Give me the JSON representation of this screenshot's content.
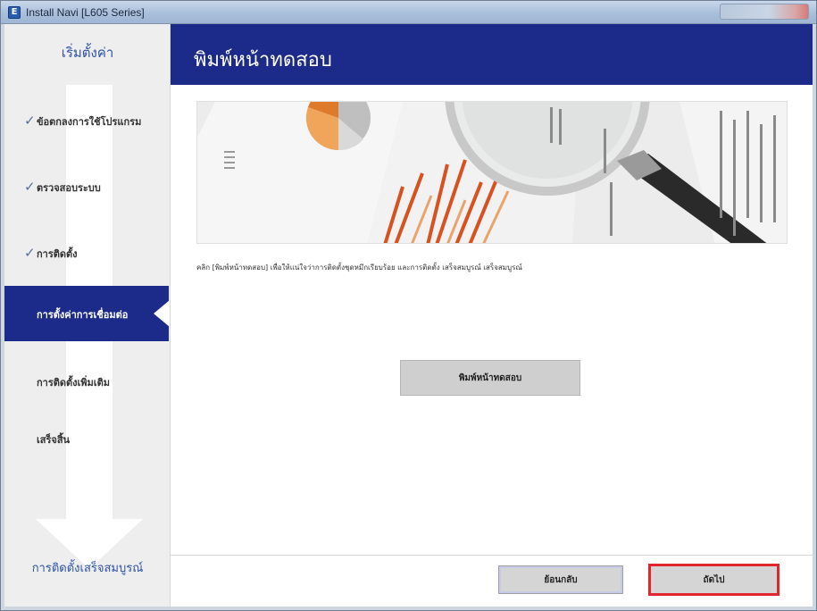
{
  "window": {
    "title": "Install Navi [L605 Series]",
    "app_icon": "E"
  },
  "sidebar": {
    "header": "เริ่มตั้งค่า",
    "steps": [
      {
        "label": "ข้อตกลงการใช้โปรแกรม",
        "done": true
      },
      {
        "label": "ตรวจสอบระบบ",
        "done": true
      },
      {
        "label": "การติดตั้ง",
        "done": true
      },
      {
        "label": "การตั้งค่าการเชื่อมต่อ",
        "active": true
      },
      {
        "label": "การติดตั้งเพิ่มเติม",
        "done": false
      },
      {
        "label": "เสร็จสิ้น",
        "done": false
      }
    ],
    "footer": "การติดตั้งเสร็จสมบูรณ์"
  },
  "main": {
    "title": "พิมพ์หน้าทดสอบ",
    "description": "คลิก [พิมพ์หน้าทดสอบ] เพื่อให้แน่ใจว่าการติดตั้งชุดหมึกเรียบร้อย และการติดตั้ง เสร็จสมบูรณ์ เสร็จสมบูรณ์",
    "print_test_label": "พิมพ์หน้าทดสอบ"
  },
  "footer": {
    "back_label": "ย้อนกลับ",
    "next_label": "ถัดไป"
  },
  "colors": {
    "header_bg": "#1c2a8a",
    "sidebar_bg": "#eeeeee",
    "accent_text": "#2d52a6",
    "highlight_border": "#e2262f"
  }
}
